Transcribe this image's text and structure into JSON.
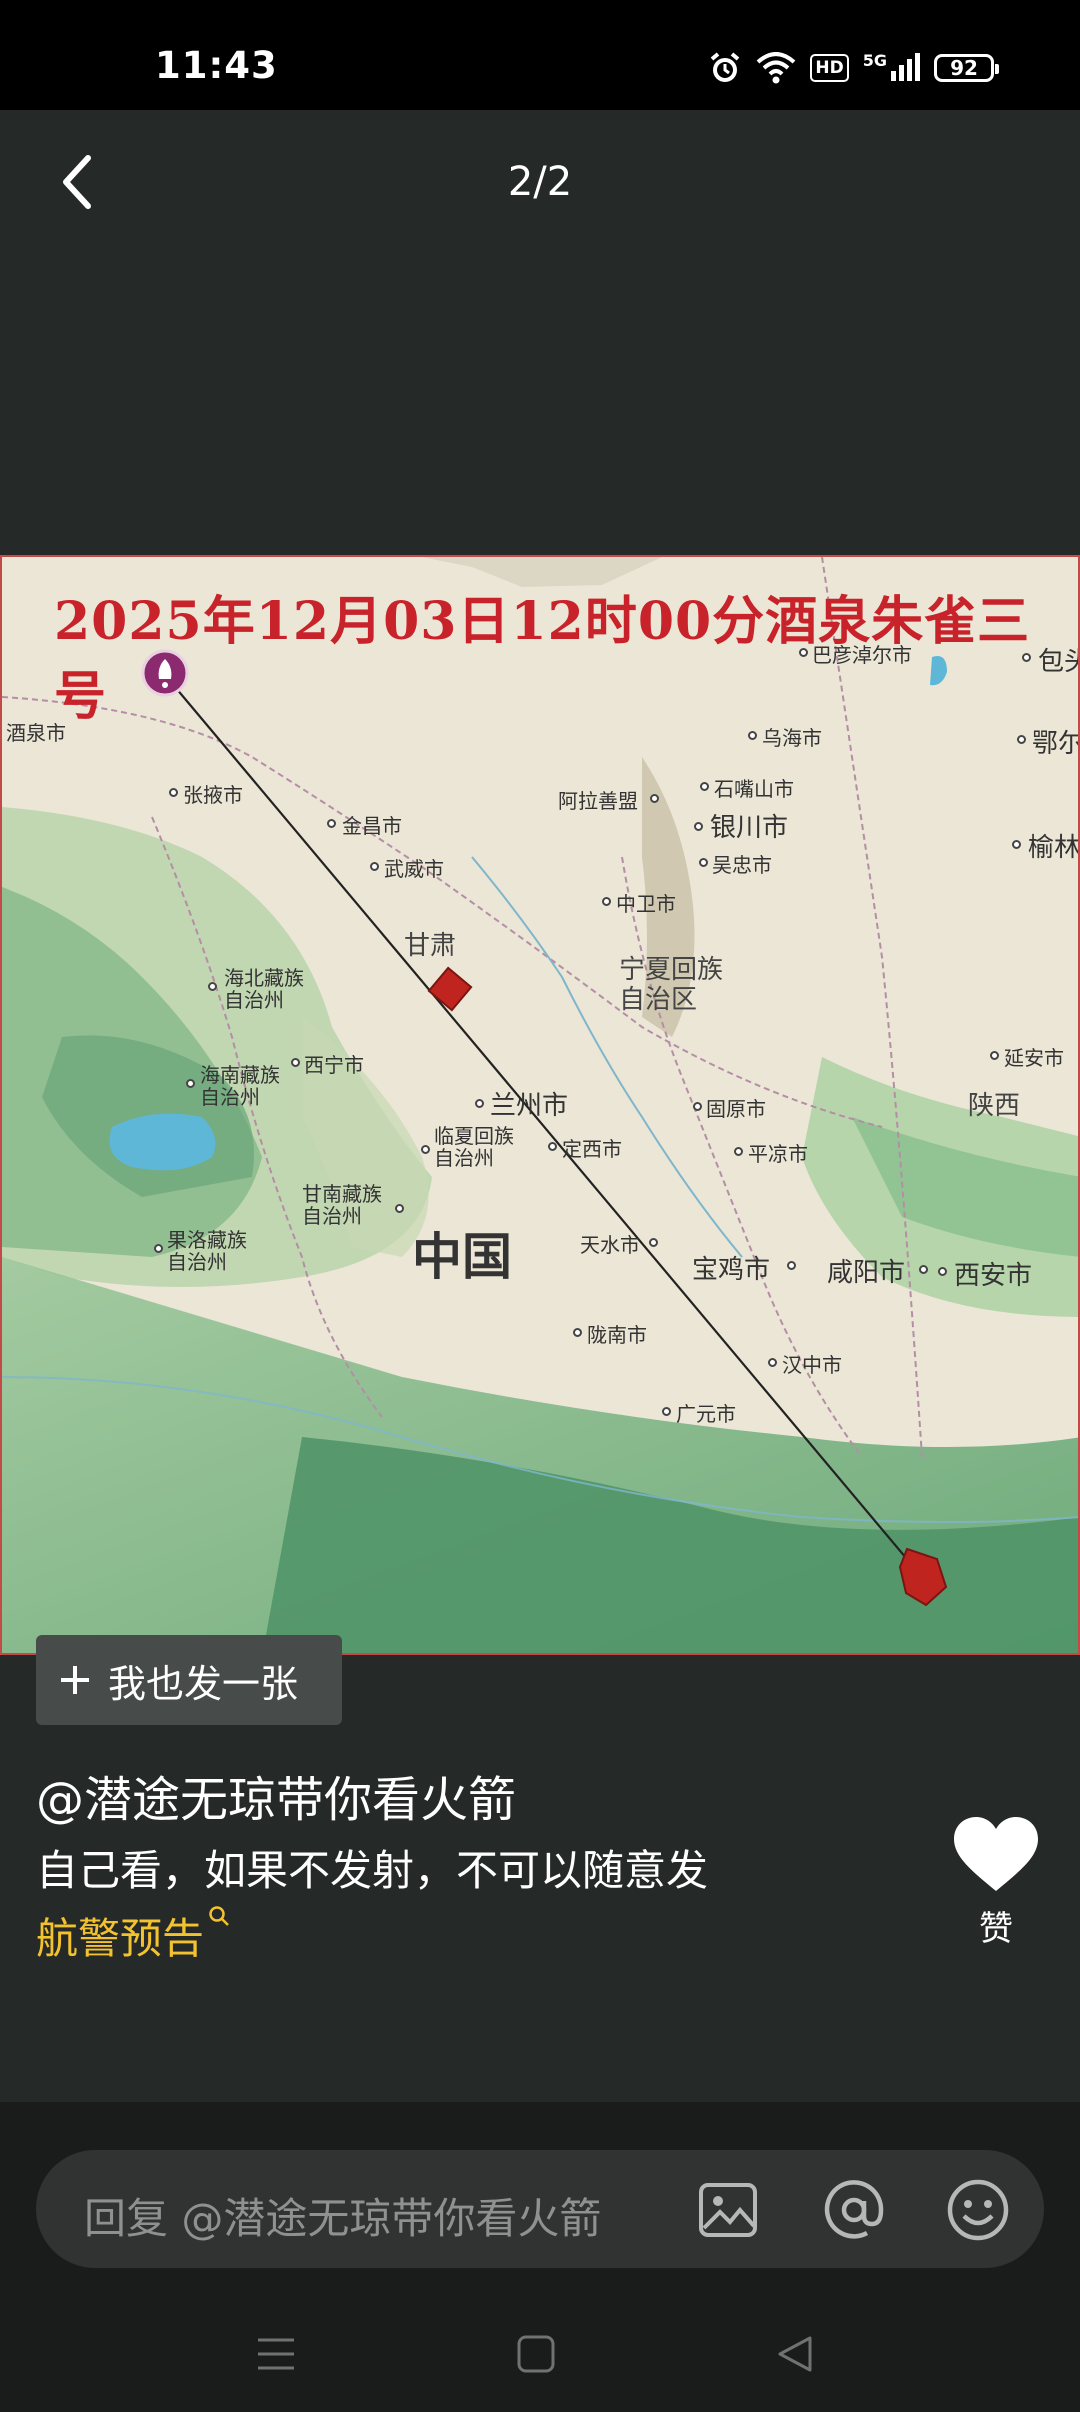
{
  "status_bar": {
    "time": "11:43",
    "icons": [
      "alarm-icon",
      "wifi-icon",
      "hd-icon",
      "5g-signal-icon",
      "battery-icon"
    ],
    "hd_label": "HD",
    "network_label": "5G",
    "battery_level": "92"
  },
  "header": {
    "page_counter": "2/2"
  },
  "map": {
    "title": "2025年12月03日12时00分酒泉朱雀三号",
    "labels": {
      "bayannur": "巴彦淖尔市",
      "baotou": "包头",
      "jiuquan": "酒泉市",
      "wuhai": "乌海市",
      "ordos": "鄂尔",
      "zhangye": "张掖市",
      "shizuishan": "石嘴山市",
      "alxa": "阿拉善盟",
      "jinchang": "金昌市",
      "yinchuan": "银川市",
      "yulin": "榆林",
      "wuwei": "武威市",
      "wuzhong": "吴忠市",
      "zhongwei": "中卫市",
      "gansu": "甘肃",
      "ningxia": "宁夏回族\n自治区",
      "haibei": "海北藏族\n自治州",
      "xining": "西宁市",
      "yanan": "延安市",
      "hainan": "海南藏族\n自治州",
      "shaanxi": "陕西",
      "lanzhou": "兰州市",
      "guyuan": "固原市",
      "linxia": "临夏回族\n自治州",
      "dingxi": "定西市",
      "pingliang": "平凉市",
      "gannan": "甘南藏族\n自治州",
      "china": "中国",
      "golog": "果洛藏族\n自治州",
      "tianshui": "天水市",
      "baoji": "宝鸡市",
      "xianyang": "咸阳市",
      "xian": "西安市",
      "longnan": "陇南市",
      "hanzhong": "汉中市",
      "guangyuan": "广元市"
    },
    "colors": {
      "title": "#c8222a",
      "trajectory": "#222222",
      "marker": "#c0241f",
      "rocket_pin": "#8b2a6e",
      "water": "#5fb7d8"
    }
  },
  "post": {
    "share_button_label": "我也发一张",
    "author": "@潜途无琼带你看火箭",
    "text": "自己看，如果不发射，不可以随意发",
    "tag": "航警预告",
    "like_label": "赞"
  },
  "reply": {
    "placeholder": "回复 @潜途无琼带你看火箭"
  },
  "nav": {
    "buttons": [
      "menu-icon",
      "home-icon",
      "back-triangle-icon"
    ]
  }
}
